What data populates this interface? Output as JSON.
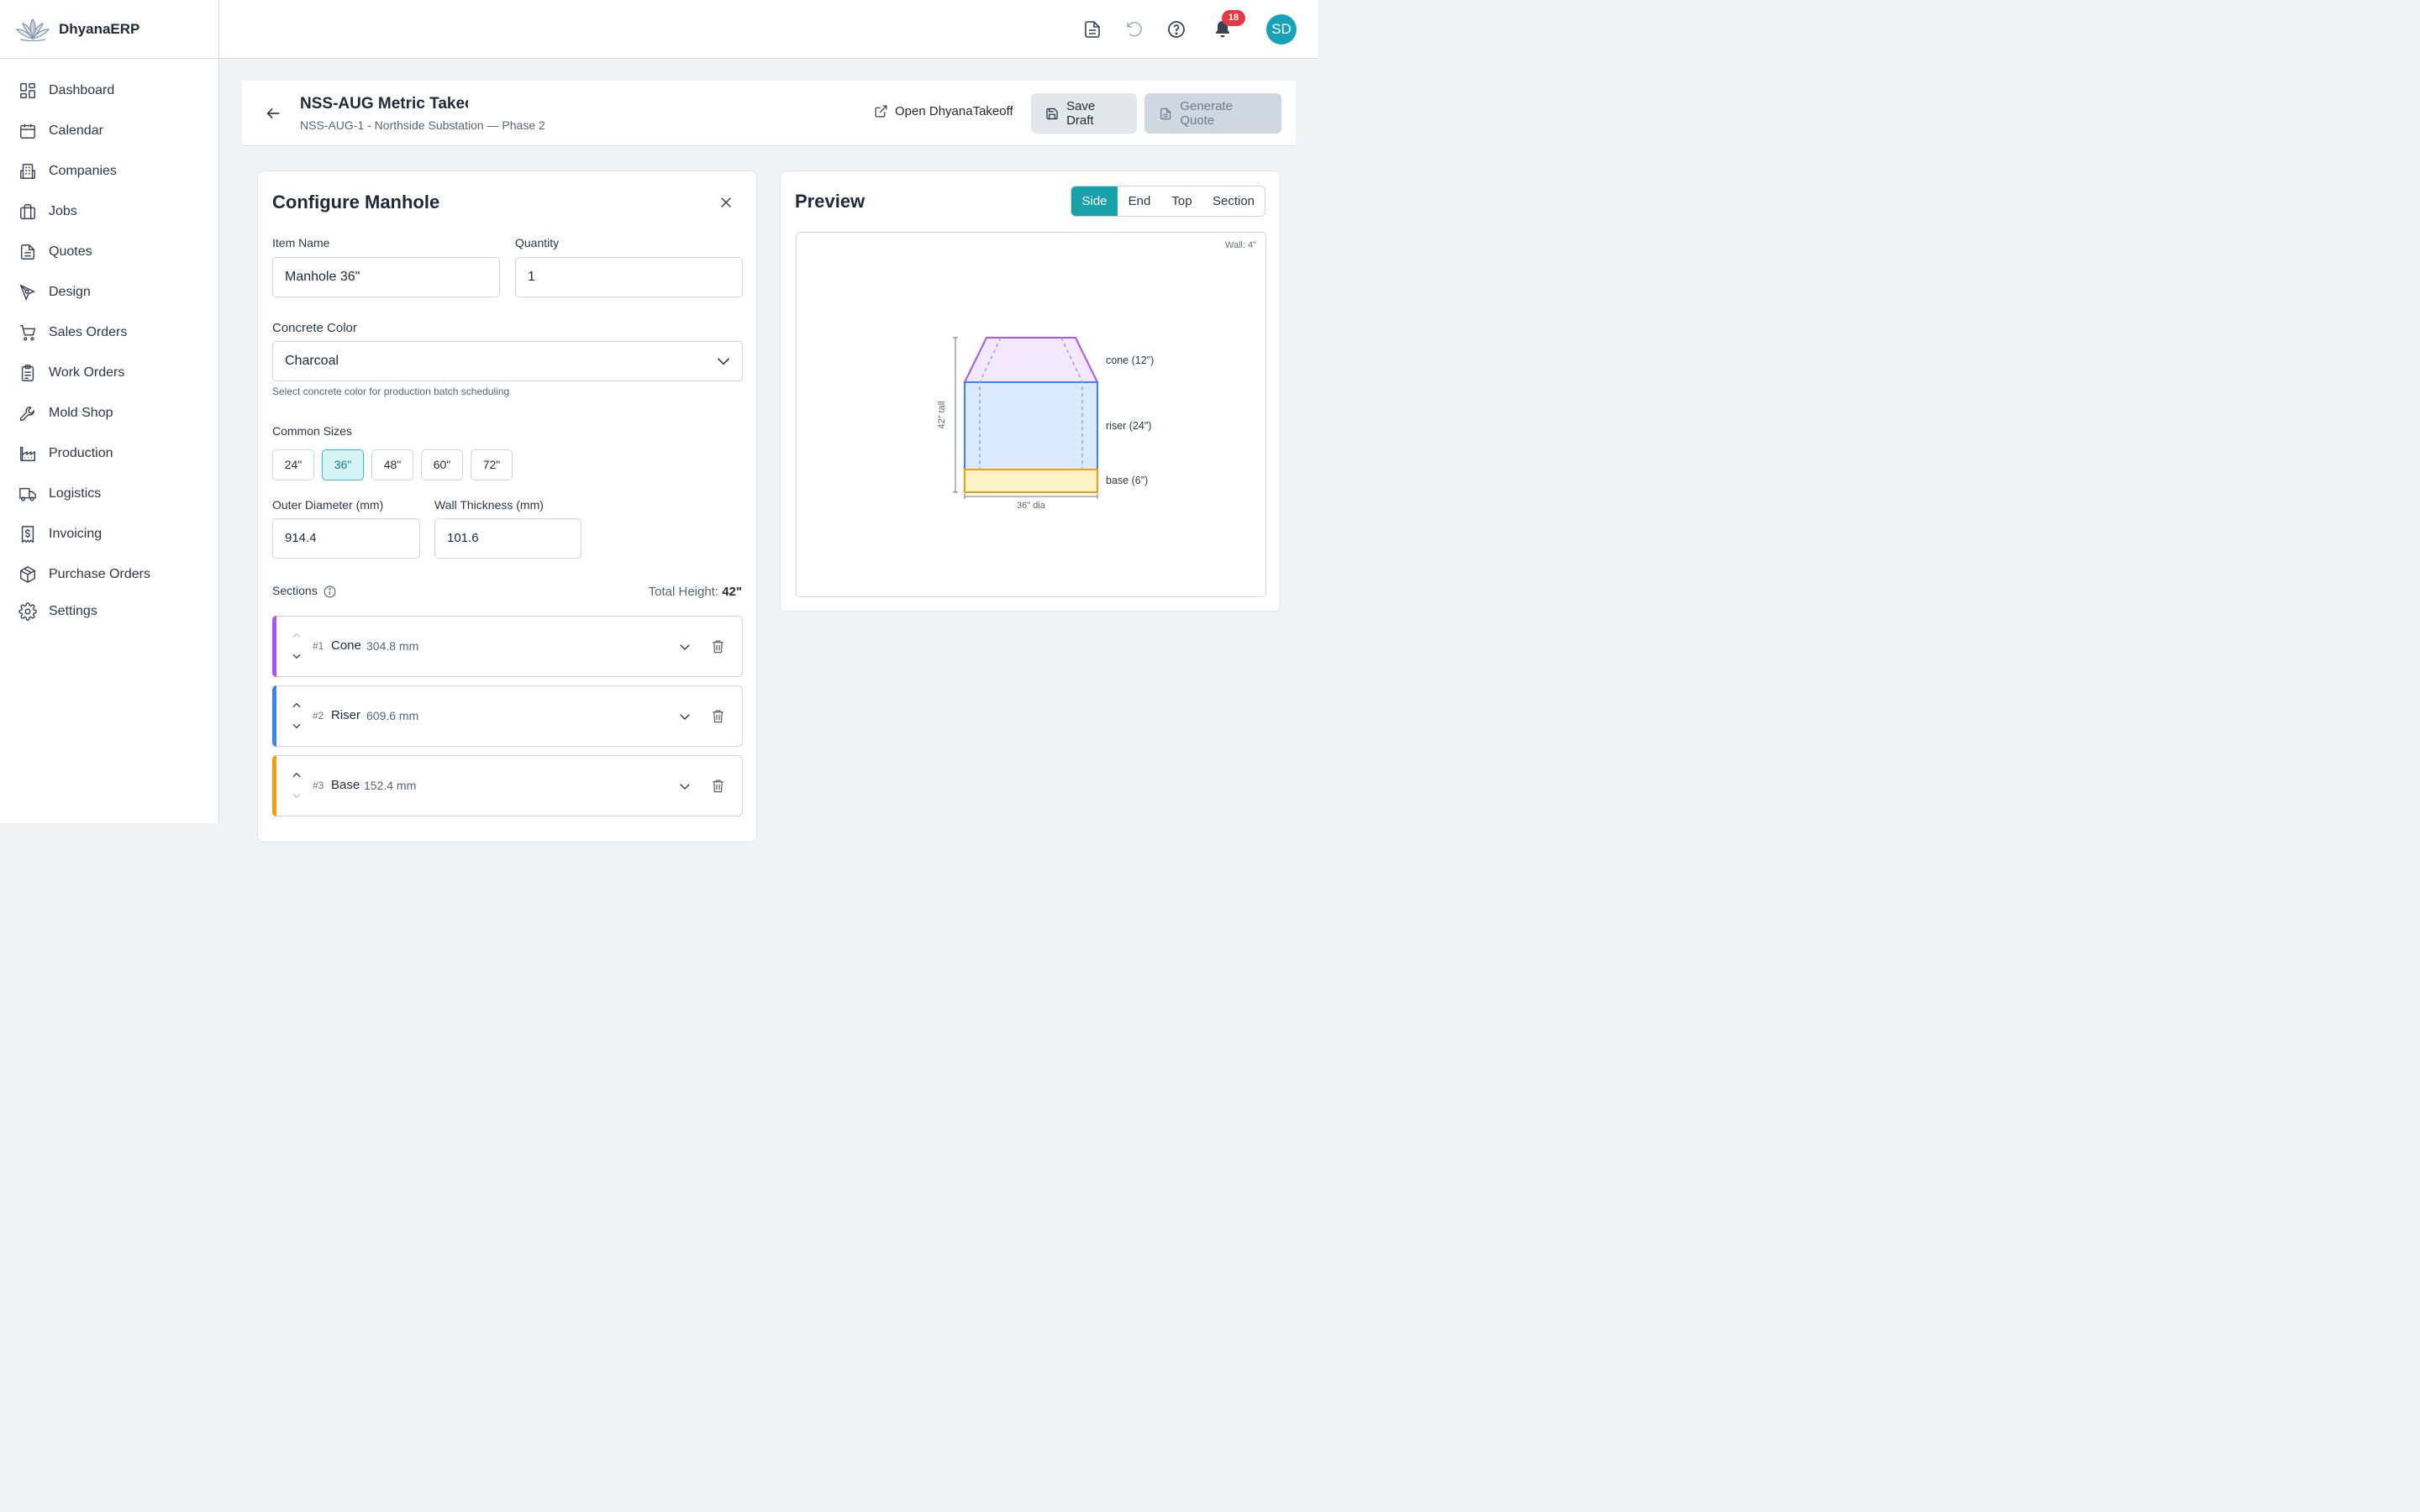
{
  "brand": {
    "name": "DhyanaERP"
  },
  "sidebar": {
    "items": [
      {
        "label": "Dashboard",
        "icon": "dashboard-icon"
      },
      {
        "label": "Calendar",
        "icon": "calendar-icon"
      },
      {
        "label": "Companies",
        "icon": "building-icon"
      },
      {
        "label": "Jobs",
        "icon": "briefcase-icon"
      },
      {
        "label": "Quotes",
        "icon": "document-icon"
      },
      {
        "label": "Design",
        "icon": "pen-tool-icon"
      },
      {
        "label": "Sales Orders",
        "icon": "cart-icon"
      },
      {
        "label": "Work Orders",
        "icon": "clipboard-icon"
      },
      {
        "label": "Mold Shop",
        "icon": "wrench-icon"
      },
      {
        "label": "Production",
        "icon": "factory-icon"
      },
      {
        "label": "Logistics",
        "icon": "truck-icon"
      },
      {
        "label": "Invoicing",
        "icon": "invoice-dollar-icon"
      },
      {
        "label": "Purchase Orders",
        "icon": "package-icon"
      },
      {
        "label": "Settings",
        "icon": "gear-icon"
      }
    ]
  },
  "topbar": {
    "notifications_count": "18",
    "avatar_initials": "SD"
  },
  "header": {
    "title": "NSS-AUG Metric Takeoff",
    "subtitle": "NSS-AUG-1 - Northside Substation — Phase 2",
    "open_link": "Open DhyanaTakeoff",
    "save_draft": "Save Draft",
    "generate_quote": "Generate Quote"
  },
  "config": {
    "title": "Configure Manhole",
    "item_name_label": "Item Name",
    "item_name_value": "Manhole 36\"",
    "quantity_label": "Quantity",
    "quantity_value": "1",
    "color_label": "Concrete Color",
    "color_value": "Charcoal",
    "color_hint": "Select concrete color for production batch scheduling",
    "common_sizes_label": "Common Sizes",
    "common_sizes": [
      "24\"",
      "36\"",
      "48\"",
      "60\"",
      "72\""
    ],
    "selected_size": "36\"",
    "outer_diameter_label": "Outer Diameter (mm)",
    "outer_diameter_value": "914.4",
    "wall_thickness_label": "Wall Thickness (mm)",
    "wall_thickness_value": "101.6",
    "sections_label": "Sections",
    "total_height_label": "Total Height:",
    "total_height_value": "42\"",
    "sections": [
      {
        "num": "#1",
        "name": "Cone",
        "size": "304.8 mm",
        "color": "#a855f7"
      },
      {
        "num": "#2",
        "name": "Riser",
        "size": "609.6 mm",
        "color": "#3b82f6"
      },
      {
        "num": "#3",
        "name": "Base",
        "size": "152.4 mm",
        "color": "#f59e0b"
      }
    ]
  },
  "preview": {
    "title": "Preview",
    "views": [
      "Side",
      "End",
      "Top",
      "Section"
    ],
    "active_view": "Side",
    "wall_note": "Wall: 4\"",
    "labels": {
      "cone": "cone (12\")",
      "riser": "riser (24\")",
      "base": "base (6\")",
      "height": "42\" tall",
      "diameter": "36\" dia"
    }
  },
  "colors": {
    "accent": "#16a2a8",
    "cone": "#a855f7",
    "riser": "#3b82f6",
    "base": "#f59e0b",
    "badge": "#e63946"
  }
}
